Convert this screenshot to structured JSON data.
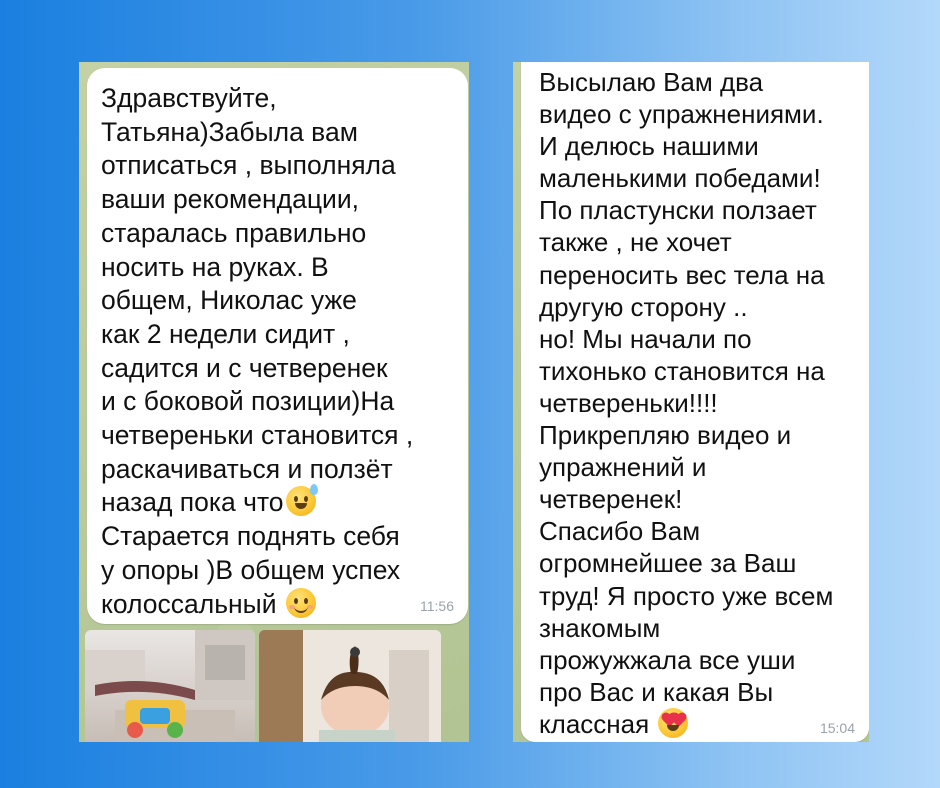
{
  "chat_left": {
    "message_lines": [
      "Здравствуйте,",
      "Татьяна)Забыла вам",
      "отписаться , выполняла",
      "ваши рекомендации,",
      "старалась правильно",
      "носить на руках. В",
      "общем, Николас уже",
      "как 2 недели сидит ,",
      "садится и с четверенек",
      "и с боковой позиции)На",
      "четвереньки становится ,",
      "раскачиваться и ползёт",
      "назад пока что",
      "Старается поднять себя",
      "у опоры )В общем успех",
      "колоссальный"
    ],
    "time": "11:56",
    "emoji_after_line_13": "grinning-sweat-emoji",
    "emoji_after_line_16": "smiling-blush-emoji"
  },
  "chat_right": {
    "message_lines": [
      "Высылаю Вам два",
      "видео с упражнениями.",
      "И делюсь нашими",
      "маленькими победами!",
      "По пластунски ползает",
      "также , не хочет",
      "переносить вес тела на",
      "другую сторону ..",
      "но! Мы начали по",
      "тихонько становится на",
      "четвереньки!!!!",
      "Прикрепляю видео и",
      "упражнений и",
      "четверенек!",
      "Спасибо Вам",
      "огромнейшее за Ваш",
      "труд! Я просто уже всем",
      "знакомым",
      "прожужжала все уши",
      "про Вас и какая Вы",
      "классная"
    ],
    "time": "15:04",
    "emoji_after_last_line": "heart-eyes-emoji"
  },
  "colors": {
    "background_left": "#1a7fe0",
    "background_right": "#b3d8fa",
    "chat_wallpaper": "#b9c99a",
    "bubble": "#ffffff",
    "text": "#111111",
    "time": "#9aa3ab"
  }
}
